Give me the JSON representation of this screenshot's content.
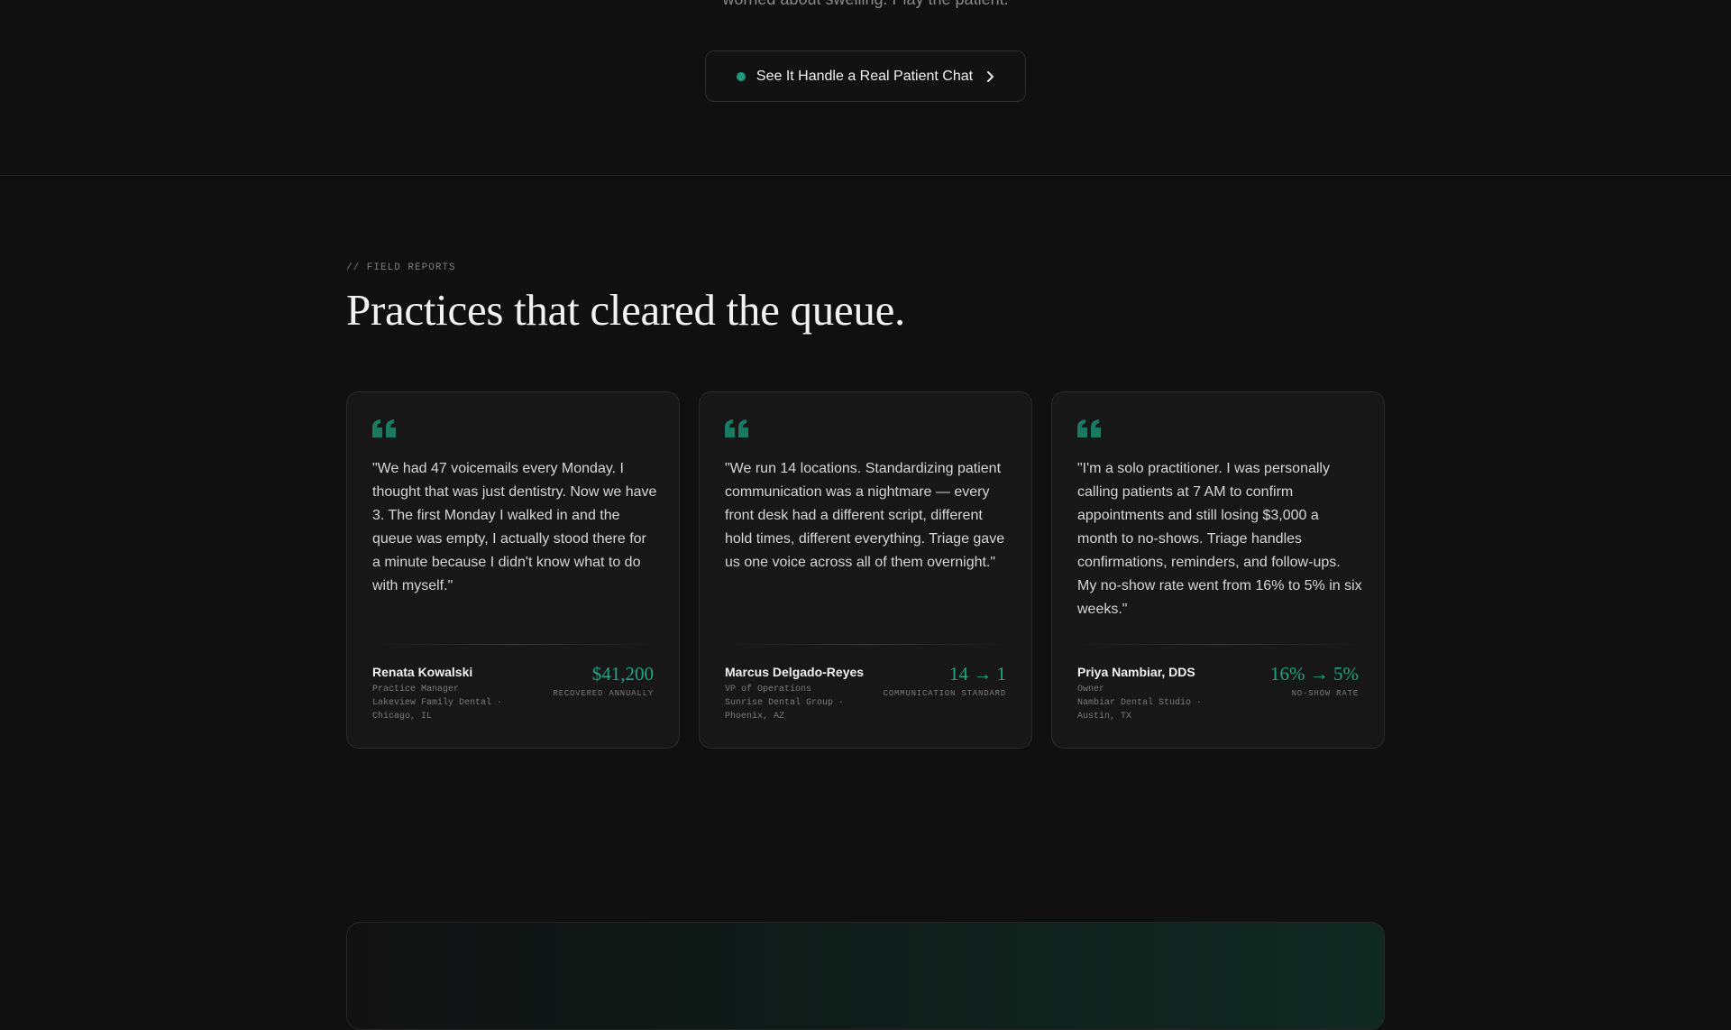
{
  "hero": {
    "caption": "worried about swelling. Play the patient.",
    "cta_label": "See It Handle a Real Patient Chat"
  },
  "section": {
    "eyebrow": "// FIELD REPORTS",
    "heading": "Practices that cleared the queue."
  },
  "testimonials": [
    {
      "quote": "\"We had 47 voicemails every Monday. I thought that was just dentistry. Now we have 3. The first Monday I walked in and the queue was empty, I actually stood there for a minute because I didn't know what to do with myself.\"",
      "name": "Renata Kowalski",
      "role": "Practice Manager",
      "org": "Lakeview Family Dental · Chicago, IL",
      "metric": "$41,200",
      "metric_label": "RECOVERED ANNUALLY"
    },
    {
      "quote": "\"We run 14 locations. Standardizing patient communication was a nightmare — every front desk had a different script, different hold times, different everything. Triage gave us one voice across all of them overnight.\"",
      "name": "Marcus Delgado-Reyes",
      "role": "VP of Operations",
      "org": "Sunrise Dental Group · Phoenix, AZ",
      "metric": "14 → 1",
      "metric_label": "COMMUNICATION STANDARD"
    },
    {
      "quote": "\"I'm a solo practitioner. I was personally calling patients at 7 AM to confirm appointments and still losing $3,000 a month to no-shows. Triage handles confirmations, reminders, and follow-ups. My no-show rate went from 16% to 5% in six weeks.\"",
      "name": "Priya Nambiar, DDS",
      "role": "Owner",
      "org": "Nambiar Dental Studio · Austin, TX",
      "metric": "16% → 5%",
      "metric_label": "NO-SHOW RATE"
    }
  ],
  "colors": {
    "accent": "#21a385",
    "background": "#101010",
    "card": "#171717"
  },
  "icons": {
    "cta_status": "status-dot-icon",
    "cta_arrow": "chevron-right-icon",
    "testimonial": "quote-icon"
  }
}
